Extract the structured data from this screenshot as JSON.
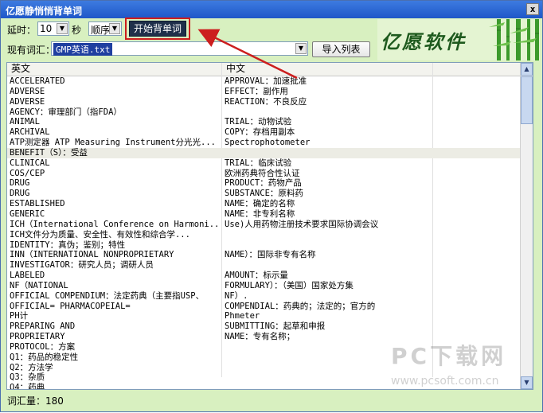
{
  "window": {
    "title": "亿愿静悄悄背单词",
    "close_glyph": "x"
  },
  "toolbar": {
    "delay_label": "延时：",
    "delay_value": "10",
    "seconds_label": "秒",
    "order_value": "顺序",
    "start_button": "开始背单词",
    "vocab_label": "现有词汇：",
    "vocab_value": "GMP英语.txt",
    "import_button": "导入列表"
  },
  "logo": {
    "text": "亿愿软件"
  },
  "list": {
    "columns": [
      "英文",
      "中文"
    ],
    "rows": [
      {
        "en": "ACCELERATED",
        "zh": "APPROVAL：加速批准"
      },
      {
        "en": "ADVERSE",
        "zh": "EFFECT：副作用"
      },
      {
        "en": "ADVERSE",
        "zh": "REACTION：不良反应"
      },
      {
        "en": "AGENCY：审理部门（指FDA）",
        "zh": ""
      },
      {
        "en": "ANIMAL",
        "zh": "TRIAL：动物试验"
      },
      {
        "en": "ARCHIVAL",
        "zh": "COPY：存档用副本"
      },
      {
        "en": "ATP测定器 ATP Measuring Instrument分光光...",
        "zh": "Spectrophotometer"
      },
      {
        "en": "BENEFIT（S）：受益",
        "zh": ""
      },
      {
        "en": "CLINICAL",
        "zh": "TRIAL：临床试验"
      },
      {
        "en": "COS/CEP",
        "zh": "欧洲药典符合性认证"
      },
      {
        "en": "DRUG",
        "zh": "PRODUCT：药物产品"
      },
      {
        "en": "DRUG",
        "zh": "SUBSTANCE：原料药"
      },
      {
        "en": "ESTABLISHED",
        "zh": "NAME：确定的名称"
      },
      {
        "en": "GENERIC",
        "zh": "NAME：非专利名称"
      },
      {
        "en": "ICH（International Conference on Harmoni...",
        "zh": "Use)人用药物注册技术要求国际协调会议"
      },
      {
        "en": "ICH文件分为质量、安全性、有效性和综合学...",
        "zh": ""
      },
      {
        "en": "IDENTITY：真伪；鉴别；特性",
        "zh": ""
      },
      {
        "en": "INN（INTERNATIONAL NONPROPRIETARY",
        "zh": "NAME）：国际非专有名称"
      },
      {
        "en": "INVESTIGATOR：研究人员；调研人员",
        "zh": ""
      },
      {
        "en": "LABELED",
        "zh": "AMOUNT：标示量"
      },
      {
        "en": "NF（NATIONAL",
        "zh": "FORMULARY）：（美国）国家处方集"
      },
      {
        "en": "OFFICIAL COMPENDIUM：法定药典（主要指USP、",
        "zh": "NF）."
      },
      {
        "en": "OFFICIAL= PHARMACOPEIAL=",
        "zh": "COMPENDIAL：药典的；法定的；官方的"
      },
      {
        "en": "PH计",
        "zh": "Phmeter"
      },
      {
        "en": "PREPARING AND",
        "zh": "SUBMITTING：起草和申报"
      },
      {
        "en": "PROPRIETARY",
        "zh": "NAME：专有名称；"
      },
      {
        "en": "PROTOCOL：方案",
        "zh": ""
      },
      {
        "en": "Q1：药品的稳定性",
        "zh": ""
      },
      {
        "en": "Q2：方法学",
        "zh": ""
      },
      {
        "en": "Q3：杂质",
        "zh": ""
      },
      {
        "en": "Q4：药典",
        "zh": ""
      }
    ],
    "highlight_index": 7
  },
  "status": {
    "count_text": "词汇量：180"
  },
  "watermark": {
    "line1": "PC下载网",
    "line2": "www.pcsoft.com.cn"
  },
  "colors": {
    "accent_frame": "#cc1e1e",
    "window_bg": "#d8f0c0",
    "selection": "#1f3fa0"
  },
  "icons": {
    "combo_arrow": "triangle-down",
    "scroll_up": "triangle-up",
    "scroll_down": "triangle-down"
  }
}
